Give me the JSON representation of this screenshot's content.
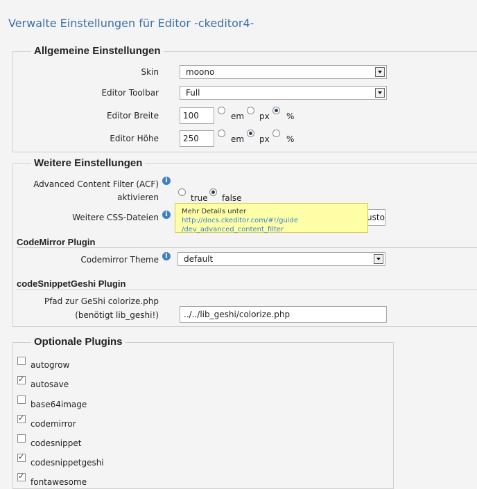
{
  "page": {
    "title": "Verwalte Einstellungen für Editor -ckeditor4-"
  },
  "general": {
    "legend": "Allgemeine Einstellungen",
    "skin_label": "Skin",
    "skin_value": "moono",
    "toolbar_label": "Editor Toolbar",
    "toolbar_value": "Full",
    "width_label": "Editor Breite",
    "width_value": "100",
    "width_units": [
      {
        "label": "em",
        "checked": false
      },
      {
        "label": "px",
        "checked": false
      },
      {
        "label": "%",
        "checked": true
      }
    ],
    "height_label": "Editor Höhe",
    "height_value": "250",
    "height_units": [
      {
        "label": "em",
        "checked": false
      },
      {
        "label": "px",
        "checked": true
      },
      {
        "label": "%",
        "checked": false
      }
    ]
  },
  "further": {
    "legend": "Weitere Einstellungen",
    "acf_label_line1": "Advanced Content Filter (ACF)",
    "acf_label_line2": "aktivieren",
    "acf_options": [
      {
        "label": "true",
        "checked": false
      },
      {
        "label": "false",
        "checked": true
      }
    ],
    "css_label": "Weitere CSS-Dateien",
    "css_value": "usto",
    "tooltip": {
      "prefix": "Mehr Details unter",
      "link_line1": "http://docs.ckeditor.com/#!/guide",
      "link_line2": "/dev_advanced_content_filter"
    },
    "codemirror_heading": "CodeMirror Plugin",
    "codemirror_theme_label": "Codemirror Theme",
    "codemirror_theme_value": "default",
    "geshi_heading": "codeSnippetGeshi Plugin",
    "geshi_label_line1": "Pfad zur GeShi colorize.php",
    "geshi_label_line2": "(benötigt lib_geshi!)",
    "geshi_value": "../../lib_geshi/colorize.php"
  },
  "plugins": {
    "legend": "Optionale Plugins",
    "items": [
      {
        "label": "autogrow",
        "checked": false
      },
      {
        "label": "autosave",
        "checked": true
      },
      {
        "label": "base64image",
        "checked": false
      },
      {
        "label": "codemirror",
        "checked": true
      },
      {
        "label": "codesnippet",
        "checked": false
      },
      {
        "label": "codesnippetgeshi",
        "checked": true
      },
      {
        "label": "fontawesome",
        "checked": true
      }
    ]
  },
  "icons": {
    "info": "info-icon",
    "dropdown": "chevron-down-icon"
  },
  "colors": {
    "title": "#3a6fa8",
    "link": "#3a7fd0",
    "tooltip_bg": "#ffffa8",
    "info": "#3f7fc4"
  }
}
